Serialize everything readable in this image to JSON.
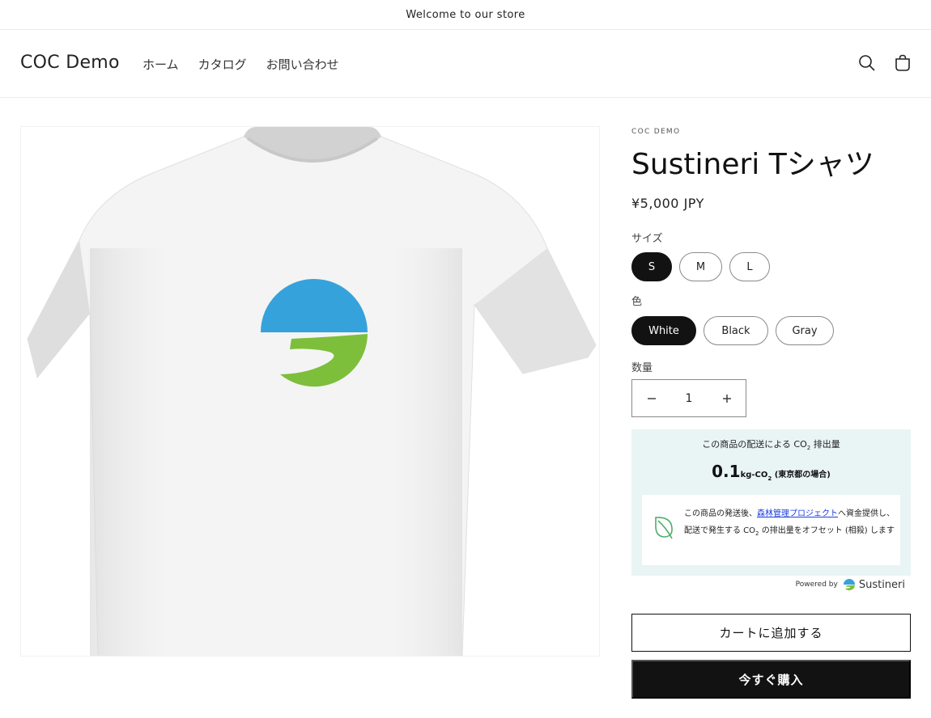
{
  "announcement": "Welcome to our store",
  "header": {
    "logo": "COC Demo",
    "nav": [
      "ホーム",
      "カタログ",
      "お問い合わせ"
    ],
    "icons": [
      "search-icon",
      "cart-icon"
    ]
  },
  "product": {
    "vendor": "COC DEMO",
    "title": "Sustineri Tシャツ",
    "price": "¥5,000 JPY",
    "size_label": "サイズ",
    "sizes": [
      "S",
      "M",
      "L"
    ],
    "selected_size": "S",
    "color_label": "色",
    "colors": [
      "White",
      "Black",
      "Gray"
    ],
    "selected_color": "White",
    "quantity_label": "数量",
    "quantity": "1",
    "add_to_cart": "カートに追加する",
    "buy_now": "今すぐ購入"
  },
  "co2": {
    "heading_prefix": "この商品の配送による CO",
    "heading_sub": "2",
    "heading_suffix": " 排出量",
    "value": "0.1",
    "unit_prefix": "kg-CO",
    "unit_sub": "2",
    "region": " (東京都の場合)",
    "note_before": "この商品の発送後、",
    "note_link": "森林管理プロジェクト",
    "note_mid": "へ資金提供し、配送で発生する CO",
    "note_sub": "2",
    "note_after": " の排出量をオフセット (相殺) します",
    "powered_by": "Powered by",
    "brand": "Sustineri"
  },
  "colors": {
    "logo_blue": "#35a2dc",
    "logo_green": "#7dbe3b",
    "panel_bg": "#e9f4f4",
    "link": "#1a3de0",
    "dark": "#121212"
  }
}
